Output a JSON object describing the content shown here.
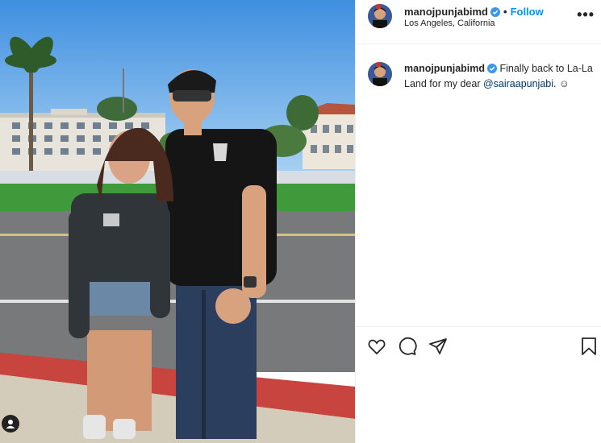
{
  "post": {
    "username": "manojpunjabimd",
    "separator": "•",
    "follow_label": "Follow",
    "location": "Los Angeles, California",
    "more_label": "•••"
  },
  "caption": {
    "username": "manojpunjabimd",
    "text_before": " Finally back to La-La Land for my dear ",
    "mention": "@sairaapunjabi",
    "text_after": ". ☺"
  },
  "icons": {
    "like": "heart-icon",
    "comment": "comment-icon",
    "share": "paper-plane-icon",
    "save": "bookmark-icon",
    "tag": "user-tag-icon",
    "verified": "verified-badge-icon"
  },
  "colors": {
    "follow": "#0095f6",
    "verified": "#3897f0",
    "mention": "#00376b"
  }
}
